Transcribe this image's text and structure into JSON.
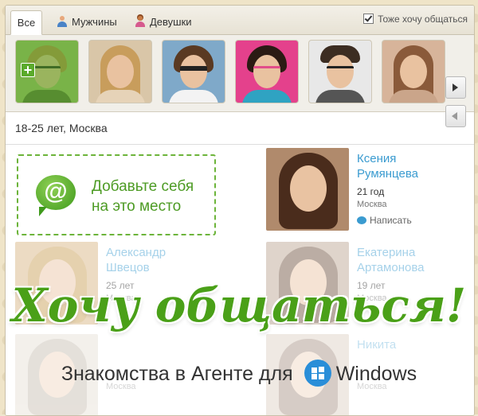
{
  "tabs": [
    {
      "label": "Все",
      "active": true
    },
    {
      "label": "Мужчины",
      "icon": "male-user-icon"
    },
    {
      "label": "Девушки",
      "icon": "female-user-icon"
    }
  ],
  "also_want": {
    "label": "Тоже хочу общаться",
    "checked": true
  },
  "filter": {
    "text": "18-25 лет, Москва"
  },
  "add_yourself": {
    "line1": "Добавьте себя",
    "line2": "на это место",
    "icon": "mail-agent-at-icon"
  },
  "profiles": [
    {
      "name": "Ксения Румянцева",
      "age": "21 год",
      "city": "Москва",
      "action": "Написать"
    },
    {
      "name": "Александр Швецов",
      "age": "25 лет",
      "city": "Москва"
    },
    {
      "name": "Екатерина Артамонова",
      "age": "19 лет",
      "city": "Москва"
    },
    {
      "name": "",
      "age": "",
      "city": "Москва"
    },
    {
      "name": "Никита",
      "age": "",
      "city": "Москва"
    }
  ],
  "banner": {
    "headline": "Хочу общаться!",
    "subline": "Знакомства в Агенте для",
    "brand": "Windows"
  },
  "colors": {
    "accent_green": "#4aa018",
    "link_blue": "#3a9bd0"
  }
}
